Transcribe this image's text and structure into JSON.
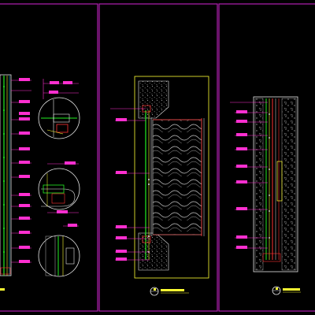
{
  "colors": {
    "background": "#000000",
    "frame": "#b020b0",
    "leader": "#ff2fd0",
    "tag_fill": "#ff2fd0",
    "green": "#22ee22",
    "yellow": "#ffff33",
    "red": "#ff3333",
    "cyan": "#22ddff",
    "white": "#e8e8e8",
    "gray": "#9a9a9a"
  },
  "sheets": [
    {
      "id": "left-section",
      "title_tag": "",
      "scale_tag": ""
    },
    {
      "id": "wall-elevation",
      "title_tag": "",
      "scale_tag": ""
    },
    {
      "id": "wall-section",
      "title_tag": "",
      "scale_tag": ""
    }
  ],
  "annotation_tags": {
    "left_sheet": [
      "",
      "",
      "",
      "",
      "",
      "",
      "",
      "",
      "",
      "",
      "",
      "",
      "",
      ""
    ],
    "middle_sheet": [
      "",
      "",
      "",
      "",
      "",
      "",
      ""
    ],
    "right_sheet": [
      "",
      "",
      "",
      "",
      "",
      "",
      "",
      "",
      ""
    ]
  }
}
